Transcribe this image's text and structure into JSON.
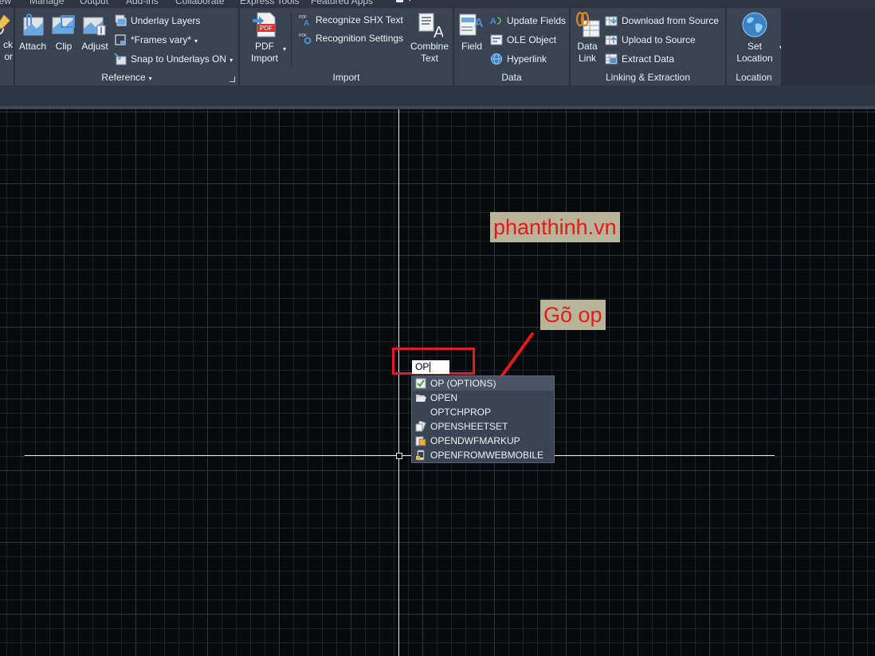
{
  "tabs": [
    "iew",
    "Manage",
    "Output",
    "Add-ins",
    "Collaborate",
    "Express Tools",
    "Featured Apps"
  ],
  "ribbon": {
    "partial_button": {
      "line1": "ck",
      "line2": "or"
    },
    "reference": {
      "title": "Reference",
      "attach": "Attach",
      "clip": "Clip",
      "adjust": "Adjust",
      "underlay_layers": "Underlay Layers",
      "frames_vary": "*Frames vary*",
      "snap_to_underlays": "Snap to Underlays ON"
    },
    "import": {
      "title": "Import",
      "pdf_import_line1": "PDF",
      "pdf_import_line2": "Import",
      "pdf_icon_text": "PDF",
      "recognize_shx": "Recognize SHX Text",
      "recognition_settings": "Recognition Settings",
      "combine_text_line1": "Combine",
      "combine_text_line2": "Text"
    },
    "data": {
      "title": "Data",
      "field": "Field",
      "update_fields": "Update Fields",
      "ole_object": "OLE Object",
      "hyperlink": "Hyperlink"
    },
    "linking": {
      "title": "Linking & Extraction",
      "data_link_line1": "Data",
      "data_link_line2": "Link",
      "download_from_source": "Download from Source",
      "upload_to_source": "Upload to Source",
      "extract_data": "Extract  Data"
    },
    "location": {
      "title": "Location",
      "set_location_line1": "Set",
      "set_location_line2": "Location"
    }
  },
  "canvas": {
    "watermark": "phanthinh.vn",
    "annotation": "Gõ op",
    "command_input": "OP"
  },
  "autocomplete": {
    "items": [
      "OP (OPTIONS)",
      "OPEN",
      "OPTCHPROP",
      "OPENSHEETSET",
      "OPENDWFMARKUP",
      "OPENFROMWEBMOBILE"
    ]
  },
  "colors": {
    "accent_red": "#e21b1b",
    "annotation_bg": "#b7b49a",
    "ribbon_bg": "#3a4352",
    "canvas_bg": "#080a0d"
  }
}
